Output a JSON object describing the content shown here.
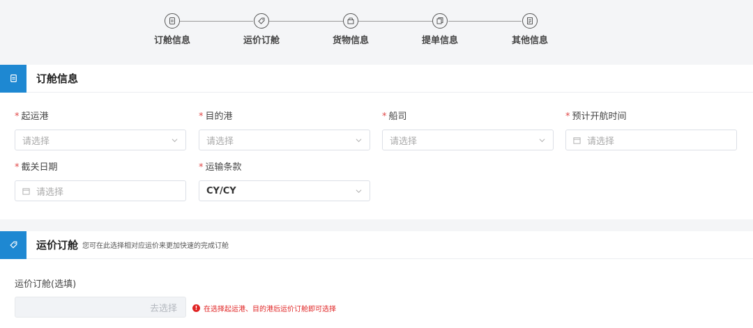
{
  "stepper": {
    "steps": [
      {
        "label": "订舱信息",
        "icon": "document-icon"
      },
      {
        "label": "运价订舱",
        "icon": "tag-icon"
      },
      {
        "label": "货物信息",
        "icon": "box-icon"
      },
      {
        "label": "提单信息",
        "icon": "bill-icon"
      },
      {
        "label": "其他信息",
        "icon": "list-icon"
      }
    ]
  },
  "booking": {
    "title": "订舱信息",
    "fields": {
      "origin_port": {
        "label": "起运港",
        "placeholder": "请选择"
      },
      "dest_port": {
        "label": "目的港",
        "placeholder": "请选择"
      },
      "carrier": {
        "label": "船司",
        "placeholder": "请选择"
      },
      "etd": {
        "label": "预计开航时间",
        "placeholder": "请选择"
      },
      "cutoff_date": {
        "label": "截关日期",
        "placeholder": "请选择"
      },
      "terms": {
        "label": "运输条款",
        "value": "CY/CY"
      }
    },
    "required_mark": "*"
  },
  "rate_booking": {
    "title": "运价订舱",
    "hint": "您可在此选择相对应运价来更加快速的完成订舱",
    "field_label": "运价订舱(选填)",
    "button_label": "去选择",
    "warning": "在选择起运港、目的港后运价订舱即可选择",
    "warning_icon": "!"
  },
  "colors": {
    "accent": "#1e88d2",
    "required": "#e04646",
    "warning": "#e02424"
  }
}
